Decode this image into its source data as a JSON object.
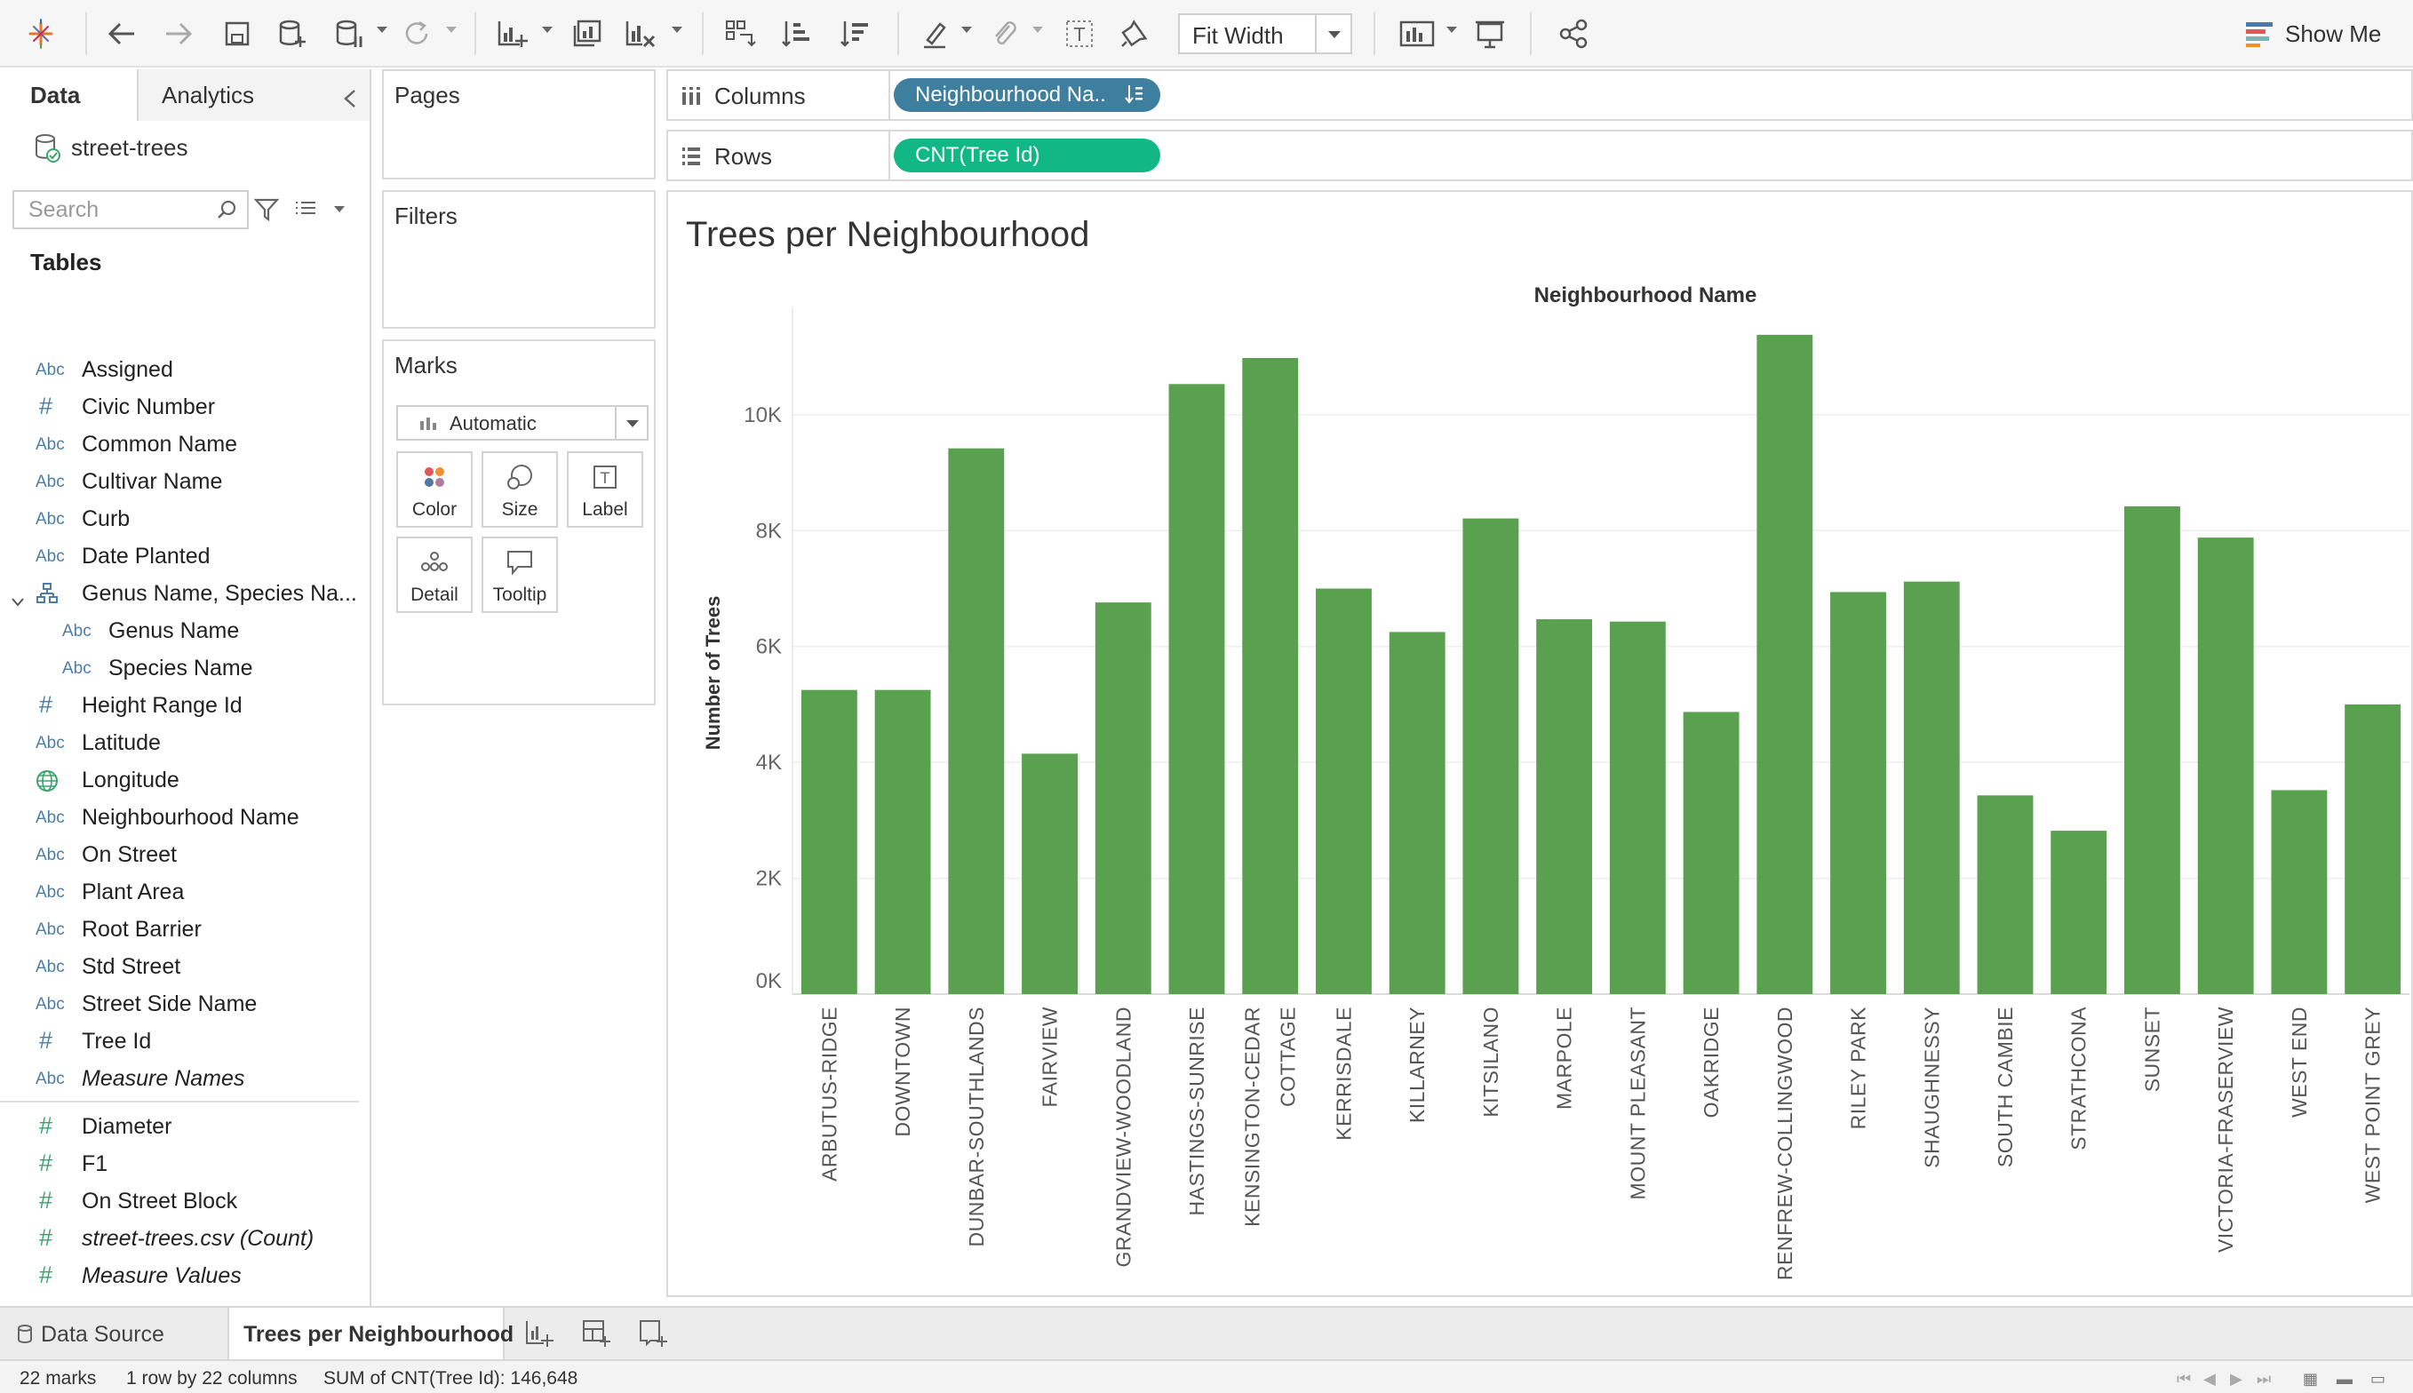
{
  "toolbar": {
    "fit_label": "Fit Width",
    "show_me_label": "Show Me"
  },
  "data_pane": {
    "tab_data": "Data",
    "tab_analytics": "Analytics",
    "datasource": "street-trees",
    "search_placeholder": "Search",
    "tables_heading": "Tables",
    "fields": [
      {
        "type": "Abc",
        "name": "Assigned",
        "indent": 0,
        "italic": false
      },
      {
        "type": "#",
        "name": "Civic Number",
        "indent": 0,
        "italic": false,
        "blue": true
      },
      {
        "type": "Abc",
        "name": "Common Name",
        "indent": 0,
        "italic": false
      },
      {
        "type": "Abc",
        "name": "Cultivar Name",
        "indent": 0,
        "italic": false
      },
      {
        "type": "Abc",
        "name": "Curb",
        "indent": 0,
        "italic": false
      },
      {
        "type": "Abc",
        "name": "Date Planted",
        "indent": 0,
        "italic": false
      },
      {
        "type": "hier",
        "name": "Genus Name, Species Na...",
        "indent": 0,
        "italic": false
      },
      {
        "type": "Abc",
        "name": "Genus Name",
        "indent": 1,
        "italic": false
      },
      {
        "type": "Abc",
        "name": "Species Name",
        "indent": 1,
        "italic": false
      },
      {
        "type": "#",
        "name": "Height Range Id",
        "indent": 0,
        "italic": false,
        "blue": true
      },
      {
        "type": "Abc",
        "name": "Latitude",
        "indent": 0,
        "italic": false
      },
      {
        "type": "globe",
        "name": "Longitude",
        "indent": 0,
        "italic": false
      },
      {
        "type": "Abc",
        "name": "Neighbourhood Name",
        "indent": 0,
        "italic": false
      },
      {
        "type": "Abc",
        "name": "On Street",
        "indent": 0,
        "italic": false
      },
      {
        "type": "Abc",
        "name": "Plant Area",
        "indent": 0,
        "italic": false
      },
      {
        "type": "Abc",
        "name": "Root Barrier",
        "indent": 0,
        "italic": false
      },
      {
        "type": "Abc",
        "name": "Std Street",
        "indent": 0,
        "italic": false
      },
      {
        "type": "Abc",
        "name": "Street Side Name",
        "indent": 0,
        "italic": false
      },
      {
        "type": "#",
        "name": "Tree Id",
        "indent": 0,
        "italic": false,
        "blue": true
      },
      {
        "type": "Abc",
        "name": "Measure Names",
        "indent": 0,
        "italic": true
      }
    ],
    "measures": [
      {
        "type": "#",
        "name": "Diameter",
        "italic": false
      },
      {
        "type": "#",
        "name": "F1",
        "italic": false
      },
      {
        "type": "#",
        "name": "On Street Block",
        "italic": false
      },
      {
        "type": "#",
        "name": "street-trees.csv (Count)",
        "italic": true
      },
      {
        "type": "#",
        "name": "Measure Values",
        "italic": true
      }
    ]
  },
  "cards": {
    "pages": "Pages",
    "filters": "Filters",
    "marks": "Marks",
    "mark_type": "Automatic",
    "mark_buttons": [
      "Color",
      "Size",
      "Label",
      "Detail",
      "Tooltip"
    ]
  },
  "shelves": {
    "columns_label": "Columns",
    "columns_pill": "Neighbourhood Na..",
    "rows_label": "Rows",
    "rows_pill": "CNT(Tree Id)"
  },
  "viz": {
    "title": "Trees per Neighbourhood"
  },
  "chart_data": {
    "type": "bar",
    "title": "Trees per Neighbourhood",
    "xlabel": "Neighbourhood Name",
    "ylabel": "Number of Trees",
    "ylim": [
      0,
      11700
    ],
    "yticks": [
      0,
      2000,
      4000,
      6000,
      8000,
      10000
    ],
    "ytick_labels": [
      "0K",
      "2K",
      "4K",
      "6K",
      "8K",
      "10K"
    ],
    "bar_color": "#59a14f",
    "categories": [
      "ARBUTUS-RIDGE",
      "DOWNTOWN",
      "DUNBAR-SOUTHLANDS",
      "FAIRVIEW",
      "GRANDVIEW-WOODLAND",
      "HASTINGS-SUNRISE",
      "KENSINGTON-CEDAR COTTAGE",
      "KERRISDALE",
      "KILLARNEY",
      "KITSILANO",
      "MARPOLE",
      "MOUNT PLEASANT",
      "OAKRIDGE",
      "RENFREW-COLLINGWOOD",
      "RILEY PARK",
      "SHAUGHNESSY",
      "SOUTH CAMBIE",
      "STRATHCONA",
      "SUNSET",
      "VICTORIA-FRASERVIEW",
      "WEST END",
      "WEST POINT GREY"
    ],
    "category_lines": [
      [
        "ARBUTUS-RIDGE"
      ],
      [
        "DOWNTOWN"
      ],
      [
        "DUNBAR-SOUTHLANDS"
      ],
      [
        "FAIRVIEW"
      ],
      [
        "GRANDVIEW-WOODLAND"
      ],
      [
        "HASTINGS-SUNRISE"
      ],
      [
        "KENSINGTON-CEDAR",
        "COTTAGE"
      ],
      [
        "KERRISDALE"
      ],
      [
        "KILLARNEY"
      ],
      [
        "KITSILANO"
      ],
      [
        "MARPOLE"
      ],
      [
        "MOUNT PLEASANT"
      ],
      [
        "OAKRIDGE"
      ],
      [
        "RENFREW-COLLINGWOOD"
      ],
      [
        "RILEY PARK"
      ],
      [
        "SHAUGHNESSY"
      ],
      [
        "SOUTH CAMBIE"
      ],
      [
        "STRATHCONA"
      ],
      [
        "SUNSET"
      ],
      [
        "VICTORIA-FRASERVIEW"
      ],
      [
        "WEST END"
      ],
      [
        "WEST POINT GREY"
      ]
    ],
    "values": [
      5250,
      5250,
      9420,
      4150,
      6760,
      10530,
      10980,
      7000,
      6250,
      8210,
      6470,
      6430,
      4870,
      11380,
      6940,
      7120,
      3430,
      2820,
      8420,
      7880,
      3520,
      5000
    ]
  },
  "sheet_tabs": {
    "data_source": "Data Source",
    "active_sheet": "Trees per Neighbourhood"
  },
  "status": {
    "marks": "22 marks",
    "dims": "1 row by 22 columns",
    "sum": "SUM of CNT(Tree Id): 146,648"
  }
}
